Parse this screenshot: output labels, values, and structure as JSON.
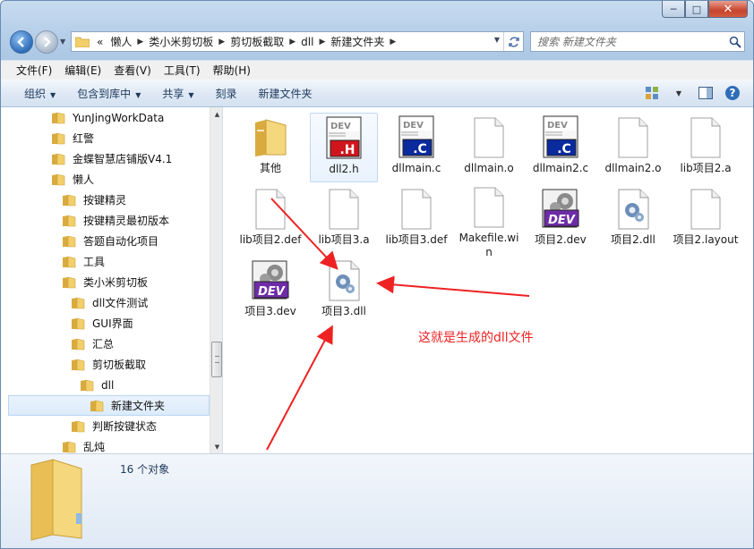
{
  "window": {
    "title_buttons": {
      "minimize": "─",
      "maximize": "□",
      "close": "✕"
    }
  },
  "nav": {
    "back_icon": "back-arrow-icon",
    "forward_icon": "forward-arrow-icon",
    "overflow": "«",
    "breadcrumbs": [
      "懒人",
      "类小米剪切板",
      "剪切板截取",
      "dll",
      "新建文件夹"
    ],
    "search_placeholder": "搜索 新建文件夹"
  },
  "menu": {
    "items": [
      "文件(F)",
      "编辑(E)",
      "查看(V)",
      "工具(T)",
      "帮助(H)"
    ]
  },
  "toolbar": {
    "organize": "组织",
    "include_in_library": "包含到库中",
    "share": "共享",
    "burn": "刻录",
    "new_folder": "新建文件夹"
  },
  "tree": {
    "items": [
      {
        "label": "YunJingWorkData",
        "level": 0,
        "selected": false
      },
      {
        "label": "红警",
        "level": 0,
        "selected": false
      },
      {
        "label": "金蝶智慧店铺版V4.1",
        "level": 0,
        "selected": false
      },
      {
        "label": "懒人",
        "level": 0,
        "selected": false
      },
      {
        "label": "按键精灵",
        "level": 1,
        "selected": false
      },
      {
        "label": "按键精灵最初版本",
        "level": 1,
        "selected": false
      },
      {
        "label": "答题自动化项目",
        "level": 1,
        "selected": false
      },
      {
        "label": "工具",
        "level": 1,
        "selected": false
      },
      {
        "label": "类小米剪切板",
        "level": 1,
        "selected": false
      },
      {
        "label": "dll文件测试",
        "level": 2,
        "selected": false
      },
      {
        "label": "GUI界面",
        "level": 2,
        "selected": false
      },
      {
        "label": "汇总",
        "level": 2,
        "selected": false
      },
      {
        "label": "剪切板截取",
        "level": 2,
        "selected": false
      },
      {
        "label": "dll",
        "level": 3,
        "selected": false
      },
      {
        "label": "新建文件夹",
        "level": 4,
        "selected": true
      },
      {
        "label": "判断按键状态",
        "level": 2,
        "selected": false
      },
      {
        "label": "乱炖",
        "level": 1,
        "selected": false
      }
    ]
  },
  "files": [
    {
      "name": "其他",
      "kind": "folder",
      "selected": false
    },
    {
      "name": "dll2.h",
      "kind": "h",
      "badge": ".H",
      "selected": true
    },
    {
      "name": "dllmain.c",
      "kind": "c",
      "badge": ".C",
      "selected": false
    },
    {
      "name": "dllmain.o",
      "kind": "blank",
      "selected": false
    },
    {
      "name": "dllmain2.c",
      "kind": "c",
      "badge": ".C",
      "selected": false
    },
    {
      "name": "dllmain2.o",
      "kind": "blank",
      "selected": false
    },
    {
      "name": "lib项目2.a",
      "kind": "blank",
      "selected": false
    },
    {
      "name": "lib项目2.def",
      "kind": "blank",
      "selected": false
    },
    {
      "name": "lib项目3.a",
      "kind": "blank",
      "selected": false
    },
    {
      "name": "lib项目3.def",
      "kind": "blank",
      "selected": false
    },
    {
      "name": "Makefile.win",
      "kind": "blank",
      "selected": false
    },
    {
      "name": "项目2.dev",
      "kind": "dev",
      "badge": "DEV",
      "selected": false
    },
    {
      "name": "项目2.dll",
      "kind": "dll",
      "selected": false
    },
    {
      "name": "项目2.layout",
      "kind": "blank",
      "selected": false
    },
    {
      "name": "项目3.dev",
      "kind": "dev",
      "badge": "DEV",
      "selected": false
    },
    {
      "name": "项目3.dll",
      "kind": "dll",
      "selected": false
    }
  ],
  "annotation": "这就是生成的dll文件",
  "details": {
    "count": "16 个对象"
  },
  "colors": {
    "annotation": "#ee2222",
    "h_badge": "#d0161c",
    "c_badge": "#0a2a9e",
    "dev_badge": "#6e2ca8",
    "folder": "#f2cf6a"
  }
}
